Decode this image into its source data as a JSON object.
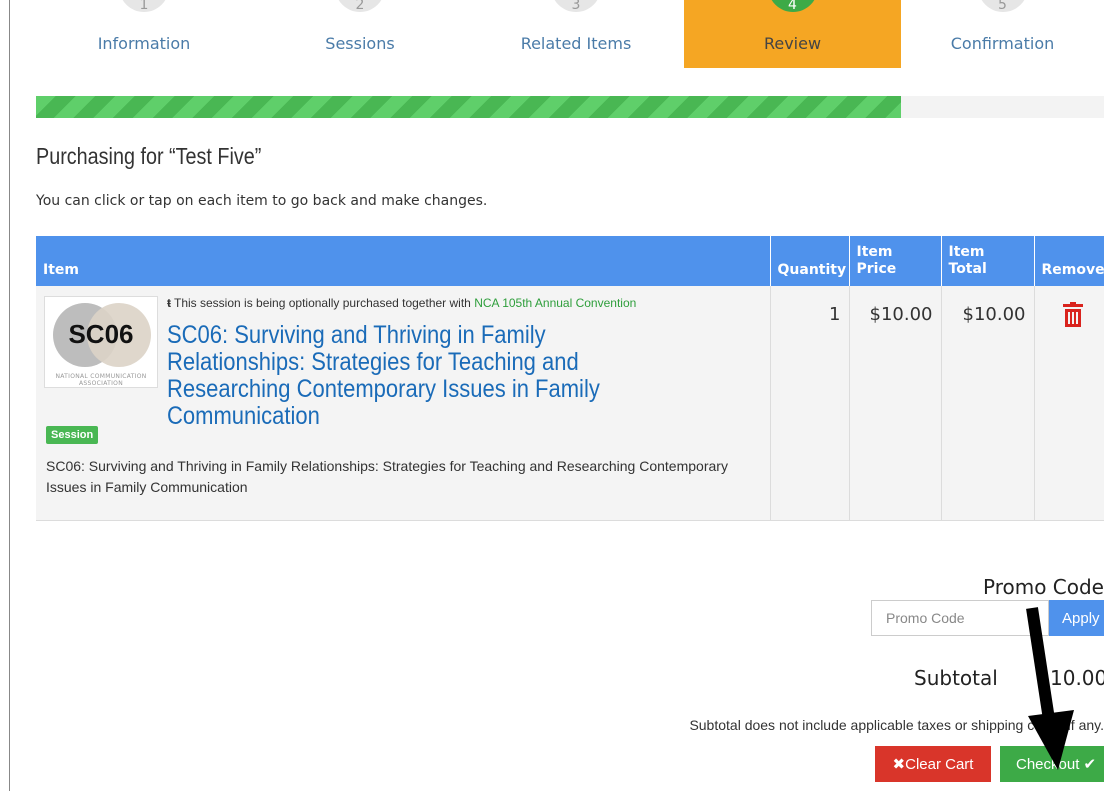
{
  "steps": [
    {
      "number": "1",
      "label": "Information"
    },
    {
      "number": "2",
      "label": "Sessions"
    },
    {
      "number": "3",
      "label": "Related Items"
    },
    {
      "number": "4",
      "label": "Review",
      "active": true
    },
    {
      "number": "5",
      "label": "Confirmation"
    }
  ],
  "progress_fraction": 0.81,
  "page": {
    "title": "Purchasing for “Test Five”",
    "hint": "You can click or tap on each item to go back and make changes."
  },
  "table": {
    "headers": {
      "item": "Item",
      "quantity": "Quantity",
      "item_price": "Item Price",
      "item_total": "Item Total",
      "remove": "Remove"
    },
    "rows": [
      {
        "thumb_code": "SC06",
        "thumb_org": "NATIONAL COMMUNICATION ASSOCIATION",
        "together_prefix": "This session is being optionally purchased together with",
        "together_link": "NCA 105th Annual Convention",
        "title": "SC06: Surviving and Thriving in Family Relationships: Strategies for Teaching and Researching Contemporary Issues in Family Communication",
        "badge": "Session",
        "description": "SC06: Surviving and Thriving in Family Relationships: Strategies for Teaching and Researching Contemporary Issues in Family Communication",
        "quantity": "1",
        "price": "$10.00",
        "total": "$10.00",
        "remove_icon": "trash-icon"
      }
    ]
  },
  "promo": {
    "label": "Promo Code",
    "placeholder": "Promo Code",
    "apply_label": "Apply"
  },
  "summary": {
    "subtotal_label": "Subtotal",
    "subtotal_value": "10.00",
    "disclaimer": "Subtotal does not include applicable taxes or shipping costs, if any."
  },
  "buttons": {
    "clear_label": "Clear Cart",
    "clear_icon": "✖",
    "checkout_label": "Checkout",
    "checkout_icon": "✔"
  },
  "colors": {
    "active_step": "#f5a623",
    "header_blue": "#4f92ec",
    "progress_green": "#49b753",
    "danger": "#d9352a",
    "success": "#3daa47"
  }
}
